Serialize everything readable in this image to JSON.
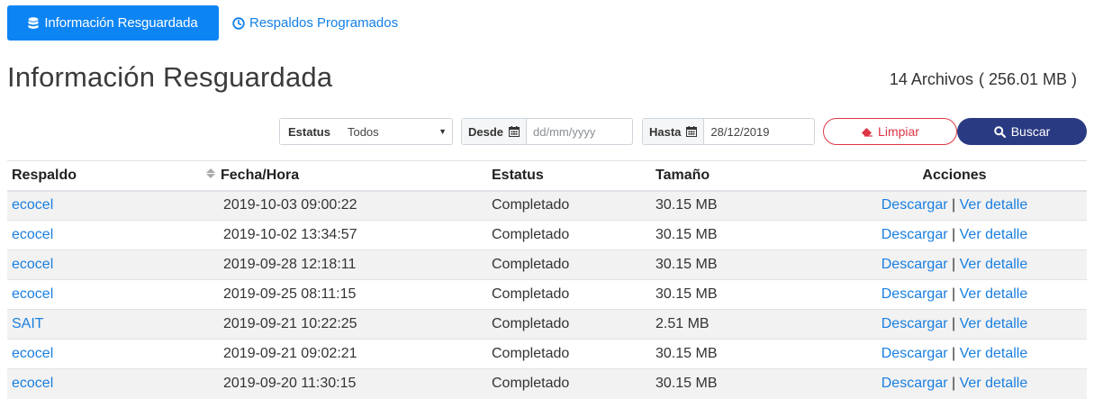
{
  "tabs": {
    "active": {
      "label": "Información Resguardada",
      "icon": "database-icon"
    },
    "scheduled": {
      "label": "Respaldos Programados",
      "icon": "clock-icon"
    }
  },
  "page": {
    "title": "Información Resguardada",
    "files_count": "14 Archivos",
    "files_size": "( 256.01 MB )"
  },
  "filters": {
    "status": {
      "label": "Estatus",
      "value": "Todos"
    },
    "from": {
      "label": "Desde",
      "placeholder": "dd/mm/yyyy",
      "value": ""
    },
    "to": {
      "label": "Hasta",
      "value": "28/12/2019"
    }
  },
  "buttons": {
    "clear": "Limpiar",
    "search": "Buscar"
  },
  "table": {
    "headers": [
      "Respaldo",
      "Fecha/Hora",
      "Estatus",
      "Tamaño",
      "Acciones"
    ],
    "action_download": "Descargar",
    "action_separator": "|",
    "action_detail": "Ver detalle",
    "rows": [
      {
        "backup": "ecocel",
        "datetime": "2019-10-03 09:00:22",
        "status": "Completado",
        "size": "30.15 MB"
      },
      {
        "backup": "ecocel",
        "datetime": "2019-10-02 13:34:57",
        "status": "Completado",
        "size": "30.15 MB"
      },
      {
        "backup": "ecocel",
        "datetime": "2019-09-28 12:18:11",
        "status": "Completado",
        "size": "30.15 MB"
      },
      {
        "backup": "ecocel",
        "datetime": "2019-09-25 08:11:15",
        "status": "Completado",
        "size": "30.15 MB"
      },
      {
        "backup": "SAIT",
        "datetime": "2019-09-21 10:22:25",
        "status": "Completado",
        "size": "2.51 MB"
      },
      {
        "backup": "ecocel",
        "datetime": "2019-09-21 09:02:21",
        "status": "Completado",
        "size": "30.15 MB"
      },
      {
        "backup": "ecocel",
        "datetime": "2019-09-20 11:30:15",
        "status": "Completado",
        "size": "30.15 MB"
      }
    ]
  },
  "colors": {
    "primary": "#0d84f4",
    "dark_button": "#2a3a82",
    "danger": "#dc3545",
    "link": "#1a7fe0"
  }
}
